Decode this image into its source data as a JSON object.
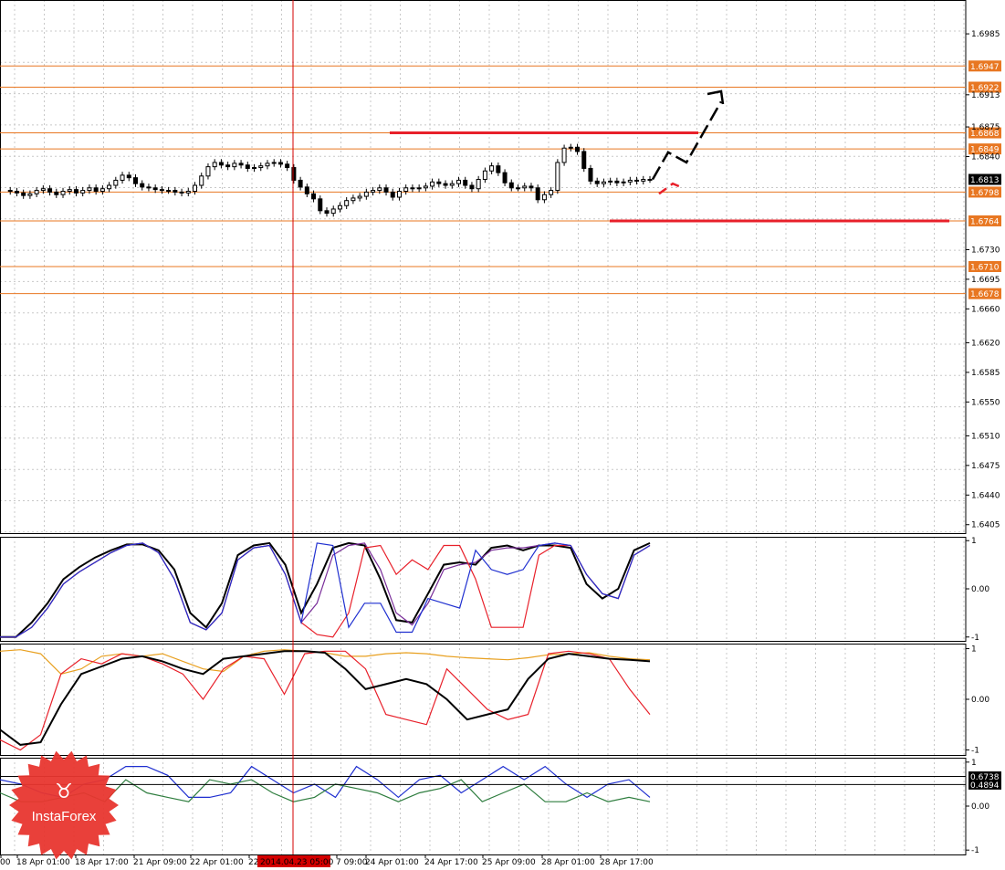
{
  "brand": {
    "logo_text": "InstaForex",
    "logo_color": "#e8362f"
  },
  "colors": {
    "candle": "#000000",
    "level_orange": "#e87722",
    "support_red": "#e8202a",
    "crosshair_red": "#d40000",
    "grid": "#c8c8c8",
    "osc_purple": "#7a2e9a",
    "osc_blue": "#1f2fd0",
    "osc_orange": "#e8a020",
    "osc_green": "#2e7d3e"
  },
  "chart_data": [
    {
      "type": "candlestick",
      "name": "price",
      "y_ticks": [
        "1.6985",
        "1.6913",
        "1.6875",
        "1.6840",
        "1.6730",
        "1.6695",
        "1.6660",
        "1.6620",
        "1.6585",
        "1.6550",
        "1.6510",
        "1.6475",
        "1.6440",
        "1.6405"
      ],
      "ylim": [
        1.6395,
        1.7025
      ],
      "current_price": "1.6813",
      "orange_levels": [
        "1.6947",
        "1.6922",
        "1.6868",
        "1.6849",
        "1.6798",
        "1.6764",
        "1.6710",
        "1.6678"
      ],
      "resistance_line": {
        "value": 1.6868,
        "label": "1.6868"
      },
      "support_line": {
        "value": 1.6764,
        "label": "1.6764"
      },
      "x_labels": [
        "00",
        "18 Apr 01:00",
        "18 Apr 17:00",
        "21 Apr 09:00",
        "22 Apr 01:00",
        "22",
        "2014.04.23 05:00",
        "7 09:00",
        "24 Apr 01:00",
        "24 Apr 17:00",
        "25 Apr 09:00",
        "28 Apr 01:00",
        "28 Apr 17:00"
      ],
      "crosshair_label": "2014.04.23 05:00",
      "close_path": [
        1.68,
        1.6799,
        1.6797,
        1.6794,
        1.6796,
        1.68,
        1.6802,
        1.6798,
        1.6795,
        1.6799,
        1.6801,
        1.6797,
        1.68,
        1.6803,
        1.6799,
        1.6802,
        1.6806,
        1.6812,
        1.6818,
        1.6815,
        1.6808,
        1.6804,
        1.6803,
        1.6801,
        1.68,
        1.68,
        1.6798,
        1.6797,
        1.6799,
        1.6806,
        1.6817,
        1.6828,
        1.6833,
        1.683,
        1.6828,
        1.6832,
        1.683,
        1.6826,
        1.6827,
        1.6829,
        1.6832,
        1.6833,
        1.6831,
        1.6827,
        1.6812,
        1.6804,
        1.6796,
        1.679,
        1.6776,
        1.6773,
        1.6778,
        1.6782,
        1.6788,
        1.6791,
        1.6793,
        1.6798,
        1.68,
        1.6803,
        1.6798,
        1.6792,
        1.6799,
        1.6803,
        1.6802,
        1.6803,
        1.6805,
        1.681,
        1.6808,
        1.6806,
        1.6808,
        1.6812,
        1.6806,
        1.6802,
        1.6813,
        1.6823,
        1.6829,
        1.6821,
        1.6809,
        1.6803,
        1.6803,
        1.6805,
        1.6803,
        1.6789,
        1.6795,
        1.68,
        1.6833,
        1.685,
        1.6851,
        1.6846,
        1.6826,
        1.6811,
        1.6808,
        1.681,
        1.6811,
        1.6809,
        1.681,
        1.6812,
        1.6811,
        1.6813,
        1.6813
      ],
      "forecast_black": [
        [
          1.6813,
          1.6813
        ],
        [
          1.6845,
          1.6845
        ],
        [
          1.6833,
          1.6833
        ],
        [
          1.6905,
          1.6905
        ]
      ],
      "forecast_red": [
        [
          1.6796,
          1.6796
        ],
        [
          1.6808,
          1.6808
        ],
        [
          1.6803,
          1.6803
        ]
      ]
    },
    {
      "type": "line",
      "name": "oscillator-1",
      "y_ticks": [
        "1",
        "0.00",
        "-1"
      ],
      "ylim": [
        -1.08,
        1.08
      ],
      "series": [
        {
          "color": "#000000",
          "values": [
            -1.0,
            -1.0,
            -0.7,
            -0.3,
            0.2,
            0.45,
            0.65,
            0.8,
            0.92,
            0.92,
            0.8,
            0.4,
            -0.5,
            -0.8,
            -0.3,
            0.7,
            0.9,
            0.95,
            0.5,
            -0.5,
            0.1,
            0.85,
            0.95,
            0.9,
            0.2,
            -0.65,
            -0.7,
            -0.1,
            0.5,
            0.55,
            0.5,
            0.85,
            0.9,
            0.8,
            0.9,
            0.9,
            0.85,
            0.1,
            -0.2,
            0.0,
            0.8,
            0.95
          ]
        },
        {
          "color": "#7a2e9a",
          "values": [
            -1.0,
            -1.0,
            -0.8,
            -0.4,
            0.1,
            0.35,
            0.55,
            0.75,
            0.9,
            0.95,
            0.75,
            0.2,
            -0.7,
            -0.85,
            -0.5,
            0.6,
            0.85,
            0.9,
            0.3,
            -0.7,
            -0.3,
            0.7,
            0.9,
            0.95,
            0.4,
            -0.5,
            -0.75,
            -0.3,
            0.4,
            0.5,
            0.55,
            0.8,
            0.85,
            0.85,
            0.9,
            0.95,
            0.9,
            0.3,
            -0.1,
            -0.2,
            0.7,
            0.9
          ]
        },
        {
          "color": "#e8202a",
          "values": [
            -1.0,
            -1.0,
            -0.8,
            -0.4,
            0.1,
            0.35,
            0.55,
            0.75,
            0.9,
            0.95,
            0.75,
            0.2,
            -0.7,
            -0.85,
            -0.5,
            0.6,
            0.85,
            0.9,
            0.3,
            -0.7,
            -0.95,
            -1.0,
            -0.5,
            0.85,
            0.9,
            0.3,
            0.6,
            0.4,
            0.9,
            0.9,
            0.2,
            -0.8,
            -0.8,
            -0.8,
            0.7,
            0.9,
            0.9,
            0.3,
            -0.1,
            -0.2,
            0.7,
            0.9
          ]
        },
        {
          "color": "#1f2fd0",
          "values": [
            -1.0,
            -1.0,
            -0.8,
            -0.4,
            0.1,
            0.35,
            0.55,
            0.75,
            0.9,
            0.95,
            0.75,
            0.2,
            -0.7,
            -0.85,
            -0.5,
            0.6,
            0.85,
            0.9,
            0.3,
            -0.7,
            0.95,
            0.9,
            -0.8,
            -0.3,
            -0.3,
            -0.9,
            -0.9,
            -0.2,
            -0.3,
            -0.4,
            0.8,
            0.4,
            0.3,
            0.4,
            0.9,
            0.95,
            0.9,
            0.3,
            -0.1,
            -0.2,
            0.7,
            0.9
          ]
        }
      ]
    },
    {
      "type": "line",
      "name": "oscillator-2",
      "y_ticks": [
        "1",
        "0.00",
        "-1"
      ],
      "ylim": [
        -1.1,
        1.1
      ],
      "series": [
        {
          "color": "#e8a020",
          "values": [
            0.95,
            0.98,
            0.9,
            0.5,
            0.6,
            0.85,
            0.9,
            0.85,
            0.9,
            0.75,
            0.6,
            0.55,
            0.85,
            0.95,
            0.98,
            0.95,
            0.92,
            0.85,
            0.85,
            0.9,
            0.92,
            0.9,
            0.85,
            0.82,
            0.8,
            0.78,
            0.82,
            0.88,
            0.9,
            0.92,
            0.85,
            0.8,
            0.78
          ]
        },
        {
          "color": "#e8202a",
          "values": [
            -0.8,
            -1.0,
            -0.7,
            0.5,
            0.8,
            0.7,
            0.9,
            0.85,
            0.7,
            0.5,
            0.0,
            0.6,
            0.85,
            0.8,
            0.1,
            0.9,
            0.95,
            0.95,
            0.6,
            -0.3,
            -0.4,
            -0.5,
            0.6,
            0.2,
            -0.2,
            -0.4,
            -0.3,
            0.9,
            0.95,
            0.9,
            0.8,
            0.2,
            -0.3
          ]
        },
        {
          "color": "#000000",
          "values": [
            -0.6,
            -0.9,
            -0.85,
            -0.1,
            0.5,
            0.65,
            0.8,
            0.85,
            0.75,
            0.6,
            0.5,
            0.8,
            0.85,
            0.9,
            0.95,
            0.95,
            0.92,
            0.6,
            0.2,
            0.3,
            0.4,
            0.3,
            0.0,
            -0.4,
            -0.3,
            -0.2,
            0.4,
            0.8,
            0.9,
            0.85,
            0.8,
            0.78,
            0.75
          ]
        }
      ]
    },
    {
      "type": "line",
      "name": "oscillator-3",
      "y_ticks": [
        "1",
        "0.00",
        "-1"
      ],
      "ylim": [
        -1.1,
        1.1
      ],
      "value_labels": [
        "0.6738",
        "0.4894"
      ],
      "series": [
        {
          "color": "#1f2fd0",
          "values": [
            0.6,
            0.5,
            0.3,
            0.2,
            0.5,
            0.6,
            0.9,
            0.9,
            0.7,
            0.2,
            0.2,
            0.3,
            0.9,
            0.6,
            0.3,
            0.5,
            0.2,
            0.9,
            0.6,
            0.2,
            0.6,
            0.7,
            0.3,
            0.6,
            0.9,
            0.6,
            0.9,
            0.5,
            0.2,
            0.5,
            0.6,
            0.2
          ]
        },
        {
          "color": "#2e7d3e",
          "values": [
            0.3,
            0.1,
            0.1,
            0.2,
            0.3,
            0.1,
            0.6,
            0.3,
            0.2,
            0.1,
            0.6,
            0.5,
            0.6,
            0.3,
            0.1,
            0.2,
            0.5,
            0.4,
            0.3,
            0.1,
            0.3,
            0.4,
            0.6,
            0.1,
            0.3,
            0.5,
            0.1,
            0.1,
            0.3,
            0.1,
            0.2,
            0.1
          ]
        }
      ]
    }
  ]
}
